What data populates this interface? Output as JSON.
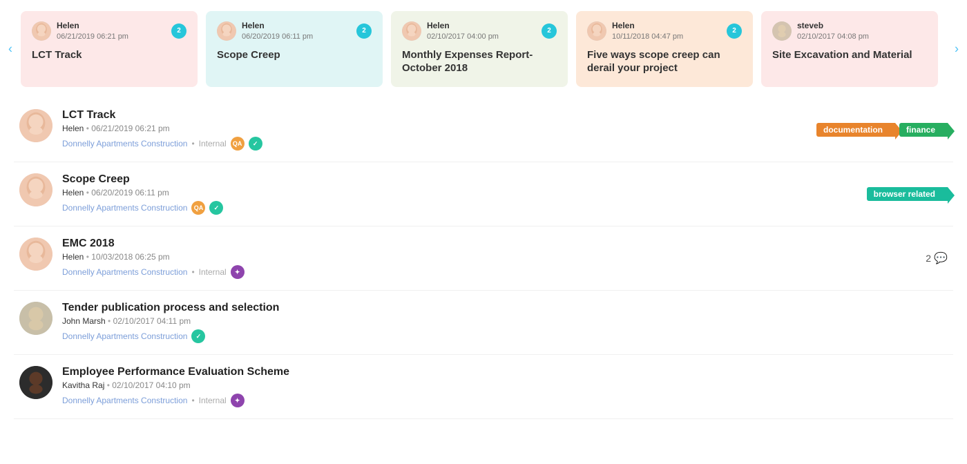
{
  "carousel": {
    "cards": [
      {
        "id": "card-1",
        "bg": "card-pink",
        "user": "Helen",
        "date": "06/21/2019 06:21 pm",
        "badge": "2",
        "title": "LCT Track",
        "avatarType": "helen"
      },
      {
        "id": "card-2",
        "bg": "card-teal",
        "user": "Helen",
        "date": "06/20/2019 06:11 pm",
        "badge": "2",
        "title": "Scope Creep",
        "avatarType": "helen"
      },
      {
        "id": "card-3",
        "bg": "card-olive",
        "user": "Helen",
        "date": "02/10/2017 04:00 pm",
        "badge": "2",
        "title": "Monthly Expenses Report- October 2018",
        "avatarType": "helen"
      },
      {
        "id": "card-4",
        "bg": "card-peach",
        "user": "Helen",
        "date": "10/11/2018 04:47 pm",
        "badge": "2",
        "title": "Five ways scope creep can derail your project",
        "avatarType": "helen"
      },
      {
        "id": "card-5",
        "bg": "card-pink",
        "user": "steveb",
        "date": "02/10/2017 04:08 pm",
        "badge": "",
        "title": "Site Excavation and Material",
        "avatarType": "steve"
      }
    ],
    "arrow_left": "‹",
    "arrow_right": "›"
  },
  "list": {
    "items": [
      {
        "id": "item-1",
        "title": "LCT Track",
        "user": "Helen",
        "date": "06/21/2019 06:21 pm",
        "project": "Donnelly Apartments Construction",
        "visibility": "Internal",
        "avatarType": "helen",
        "avatars": [
          "QA",
          "teal"
        ],
        "tags": [
          {
            "label": "documentation",
            "color": "rt-orange"
          },
          {
            "label": "finance",
            "color": "rt-green"
          }
        ],
        "commentCount": ""
      },
      {
        "id": "item-2",
        "title": "Scope Creep",
        "user": "Helen",
        "date": "06/20/2019 06:11 pm",
        "project": "Donnelly Apartments Construction",
        "visibility": "",
        "avatarType": "helen",
        "avatars": [
          "QA",
          "teal"
        ],
        "tags": [
          {
            "label": "browser related",
            "color": "rt-teal"
          }
        ],
        "commentCount": ""
      },
      {
        "id": "item-3",
        "title": "EMC 2018",
        "user": "Helen",
        "date": "10/03/2018 06:25 pm",
        "project": "Donnelly Apartments Construction",
        "visibility": "Internal",
        "avatarType": "helen",
        "avatars": [
          "purple"
        ],
        "tags": [],
        "commentCount": "2"
      },
      {
        "id": "item-4",
        "title": "Tender publication process and selection",
        "user": "John Marsh",
        "date": "02/10/2017 04:11 pm",
        "project": "Donnelly Apartments Construction",
        "visibility": "",
        "avatarType": "john",
        "avatars": [
          "teal"
        ],
        "tags": [],
        "commentCount": ""
      },
      {
        "id": "item-5",
        "title": "Employee Performance Evaluation Scheme",
        "user": "Kavitha Raj",
        "date": "02/10/2017 04:10 pm",
        "project": "Donnelly Apartments Construction",
        "visibility": "Internal",
        "avatarType": "kavitha",
        "avatars": [
          "purple"
        ],
        "tags": [],
        "commentCount": ""
      }
    ]
  }
}
